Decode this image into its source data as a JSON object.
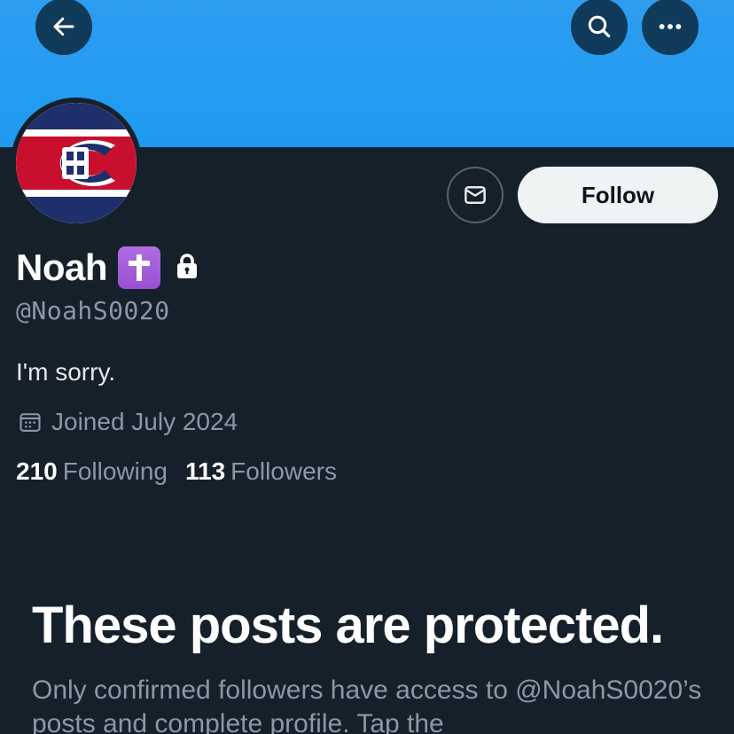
{
  "header": {
    "back_icon": "arrow-left-icon",
    "search_icon": "search-icon",
    "more_icon": "more-dots-icon",
    "banner_color": "#1d9bf0"
  },
  "profile": {
    "avatar": "montreal-canadiens-logo",
    "name": "Noah",
    "name_badge": "latin-cross-emoji",
    "protected_icon": "lock-icon",
    "handle": "@NoahS0020",
    "bio": "I'm sorry.",
    "joined": "Joined July 2024",
    "following_count": "210",
    "following_label": "Following",
    "followers_count": "113",
    "followers_label": "Followers"
  },
  "actions": {
    "message_icon": "envelope-icon",
    "follow_label": "Follow"
  },
  "protected": {
    "title": "These posts are protected.",
    "description": "Only confirmed followers have access to @NoahS0020’s posts and complete profile. Tap the"
  },
  "colors": {
    "background": "#15202b",
    "secondary_text": "#8b98a5",
    "follow_button_bg": "#eff3f4"
  }
}
